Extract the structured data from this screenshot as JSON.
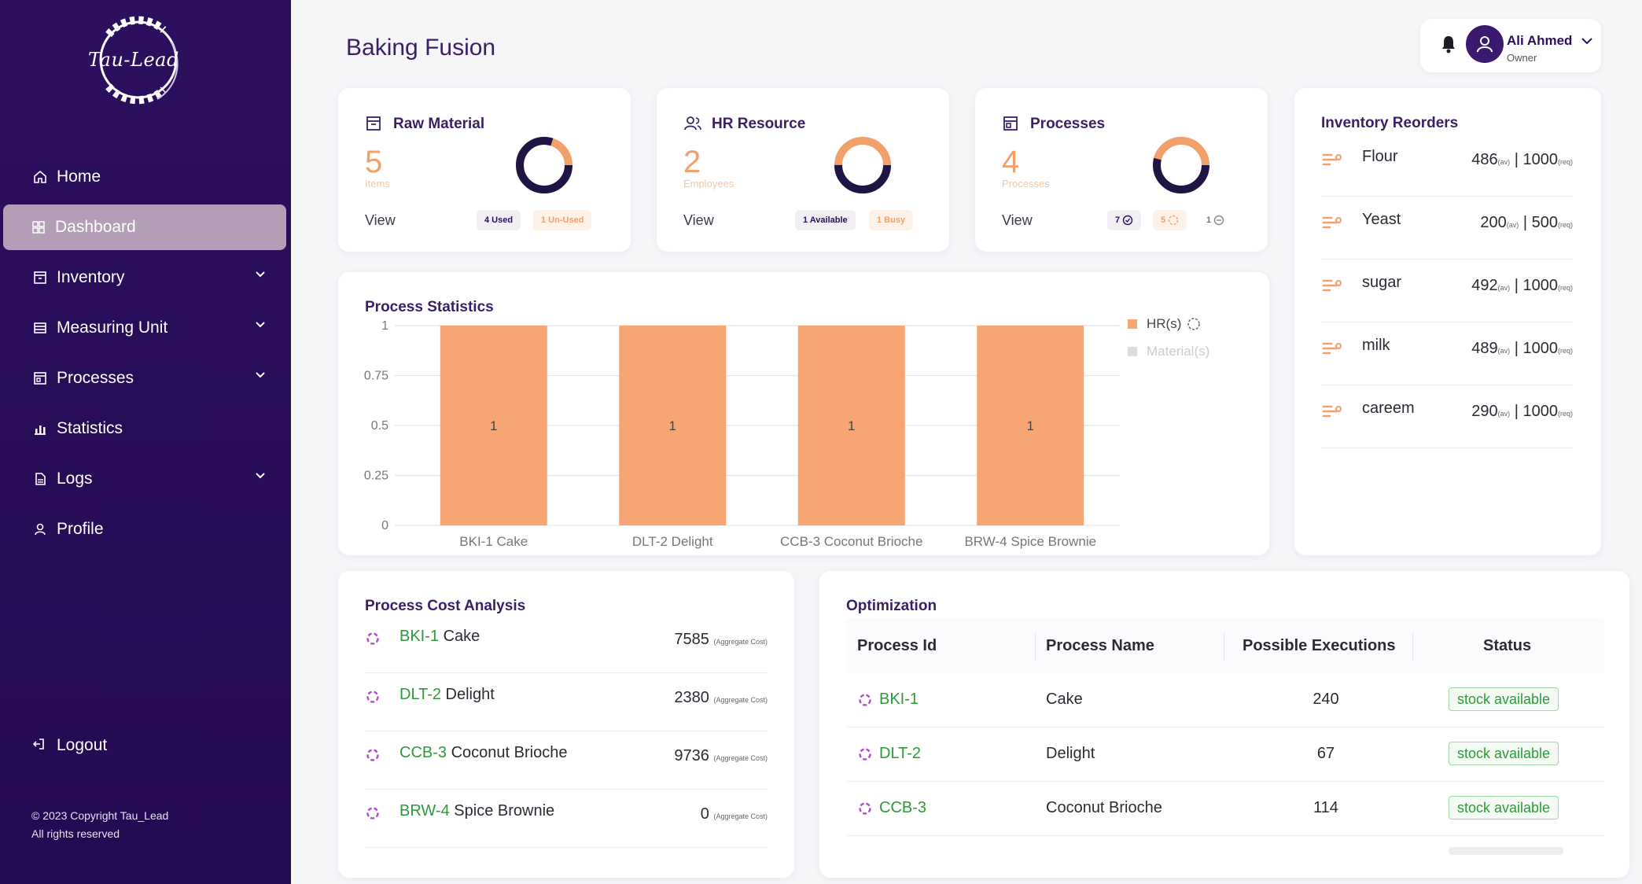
{
  "sidebar": {
    "logo_text": "Tau-Lead",
    "nav": [
      {
        "label": "Home",
        "icon": "home-icon",
        "has_children": false,
        "active": false
      },
      {
        "label": "Dashboard",
        "icon": "dashboard-icon",
        "has_children": false,
        "active": true
      },
      {
        "label": "Inventory",
        "icon": "inventory-icon",
        "has_children": true,
        "active": false
      },
      {
        "label": "Measuring Unit",
        "icon": "measuring-unit-icon",
        "has_children": true,
        "active": false
      },
      {
        "label": "Processes",
        "icon": "processes-icon",
        "has_children": true,
        "active": false
      },
      {
        "label": "Statistics",
        "icon": "statistics-icon",
        "has_children": false,
        "active": false
      },
      {
        "label": "Logs",
        "icon": "logs-icon",
        "has_children": true,
        "active": false
      },
      {
        "label": "Profile",
        "icon": "profile-icon",
        "has_children": false,
        "active": false
      }
    ],
    "logout": "Logout",
    "copyright_line1": "© 2023 Copyright Tau_Lead",
    "copyright_line2": "All rights reserved"
  },
  "header": {
    "title": "Baking Fusion",
    "user_name": "Ali Ahmed",
    "user_role": "Owner"
  },
  "cards": {
    "raw_material": {
      "title": "Raw Material",
      "count": "5",
      "unit": "Items",
      "view": "View",
      "pill1": "4 Used",
      "pill2": "1 Un-Used",
      "donut_fraction_dark": 0.8
    },
    "hr_resource": {
      "title": "HR Resource",
      "count": "2",
      "unit": "Employees",
      "view": "View",
      "pill1": "1 Available",
      "pill2": "1 Busy",
      "donut_fraction_dark": 0.5
    },
    "processes": {
      "title": "Processes",
      "count": "4",
      "unit": "Processes",
      "view": "View",
      "pill1": "7",
      "pill2": "5",
      "pill3": "1",
      "donut_fraction_dark": 0.54
    }
  },
  "inventory_reorders": {
    "title": "Inventory Reorders",
    "items": [
      {
        "name": "Flour",
        "available": "486",
        "required": "1000"
      },
      {
        "name": "Yeast",
        "available": "200",
        "required": "500"
      },
      {
        "name": "sugar",
        "available": "492",
        "required": "1000"
      },
      {
        "name": "milk",
        "available": "489",
        "required": "1000"
      },
      {
        "name": "careem",
        "available": "290",
        "required": "1000"
      }
    ],
    "available_suffix": "(av)",
    "required_suffix": "(req)"
  },
  "process_statistics": {
    "title": "Process Statistics",
    "legend_hr": "HR(s)",
    "legend_material": "Material(s)"
  },
  "chart_data": {
    "type": "bar",
    "categories": [
      "BKI-1 Cake",
      "DLT-2 Delight",
      "CCB-3 Coconut Brioche",
      "BRW-4 Spice Brownie"
    ],
    "series": [
      {
        "name": "HR(s)",
        "values": [
          1,
          1,
          1,
          1
        ],
        "color": "#f8a574"
      },
      {
        "name": "Material(s)",
        "values": [],
        "color": "#dddddd"
      }
    ],
    "yticks": [
      "0",
      "0.25",
      "0.5",
      "0.75",
      "1"
    ],
    "ylim": [
      0,
      1
    ],
    "grid": true,
    "legend_position": "top-right",
    "data_labels": [
      "1",
      "1",
      "1",
      "1"
    ]
  },
  "process_cost": {
    "title": "Process Cost Analysis",
    "suffix": "(Aggregate Cost)",
    "items": [
      {
        "id": "BKI-1",
        "name": "Cake",
        "cost": "7585"
      },
      {
        "id": "DLT-2",
        "name": "Delight",
        "cost": "2380"
      },
      {
        "id": "CCB-3",
        "name": "Coconut Brioche",
        "cost": "9736"
      },
      {
        "id": "BRW-4",
        "name": "Spice Brownie",
        "cost": "0"
      }
    ]
  },
  "optimization": {
    "title": "Optimization",
    "headers": [
      "Process Id",
      "Process Name",
      "Possible Executions",
      "Status"
    ],
    "rows": [
      {
        "id": "BKI-1",
        "name": "Cake",
        "executions": "240",
        "status": "stock available"
      },
      {
        "id": "DLT-2",
        "name": "Delight",
        "executions": "67",
        "status": "stock available"
      },
      {
        "id": "CCB-3",
        "name": "Coconut Brioche",
        "executions": "114",
        "status": "stock available"
      }
    ]
  },
  "colors": {
    "sidebar_bg": "#2c0f5e",
    "active_nav": "#b49db6",
    "accent_orange": "#f2a06a",
    "accent_dark": "#2c0f5e",
    "green": "#2d9a3a"
  }
}
